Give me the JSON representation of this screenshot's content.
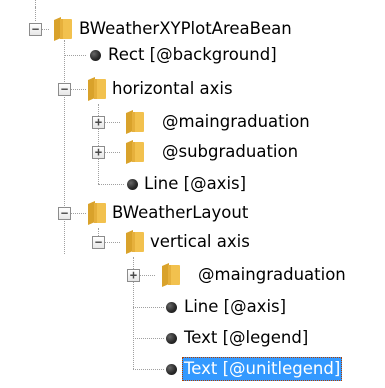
{
  "tree": {
    "nodes": [
      {
        "label": "BWeatherXYPlotAreaBean",
        "type": "folder",
        "state": "expanded"
      },
      {
        "label": "Rect [@background]",
        "type": "leaf"
      },
      {
        "label": "horizontal axis",
        "type": "folder",
        "state": "expanded"
      },
      {
        "label": "@maingraduation",
        "type": "folder",
        "state": "collapsed"
      },
      {
        "label": "@subgraduation",
        "type": "folder",
        "state": "collapsed"
      },
      {
        "label": "Line [@axis]",
        "type": "leaf"
      },
      {
        "label": "BWeatherLayout",
        "type": "folder",
        "state": "expanded"
      },
      {
        "label": "vertical axis",
        "type": "folder",
        "state": "expanded"
      },
      {
        "label": "@maingraduation",
        "type": "folder",
        "state": "collapsed"
      },
      {
        "label": "Line [@axis]",
        "type": "leaf"
      },
      {
        "label": "Text [@legend]",
        "type": "leaf"
      },
      {
        "label": "Text [@unitlegend]",
        "type": "leaf",
        "selected": true
      }
    ],
    "toggle_symbols": {
      "expanded": "−",
      "collapsed": "+"
    },
    "colors": {
      "selection": "#3399ff",
      "folder": "#f2c14e",
      "connector": "#a0a0a0"
    }
  }
}
